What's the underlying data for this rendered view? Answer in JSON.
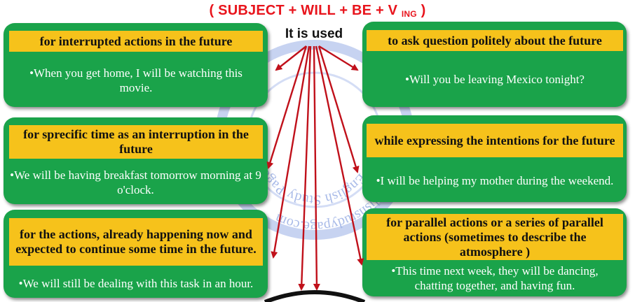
{
  "formula": {
    "main": "( SUBJECT + WILL + BE + V ",
    "sub": "ING",
    "close": " )"
  },
  "center_label": "It is used",
  "cards": [
    {
      "heading": "for interrupted actions in the future",
      "text": "•When you get home, I will be watching this movie."
    },
    {
      "heading": "to ask question politely about the future",
      "text": "•Will you be leaving Mexico tonight?"
    },
    {
      "heading": "for sprecific time as an interruption in the future",
      "text": "•We will be having breakfast tomorrow morning at 9 o'clock."
    },
    {
      "heading": "while expressing the intentions for the future",
      "text": "•I will be helping my mother during the weekend."
    },
    {
      "heading": "for the actions, already happening now and expected to continue some time in the future.",
      "text": "•We will still be dealing with this task in an hour."
    },
    {
      "heading": "for parallel actions or a series of parallel actions (sometimes to describe the atmosphere )",
      "text": "•This time next week, they will be dancing, chatting together, and having fun."
    }
  ],
  "watermark": {
    "outer": "www.englishstudypage.com",
    "inner": "English Study Page"
  },
  "colors": {
    "card_green": "#1aa34a",
    "heading_yellow": "#f6c21b",
    "arrow_red": "#c0101a",
    "formula_red": "#e8141c"
  }
}
